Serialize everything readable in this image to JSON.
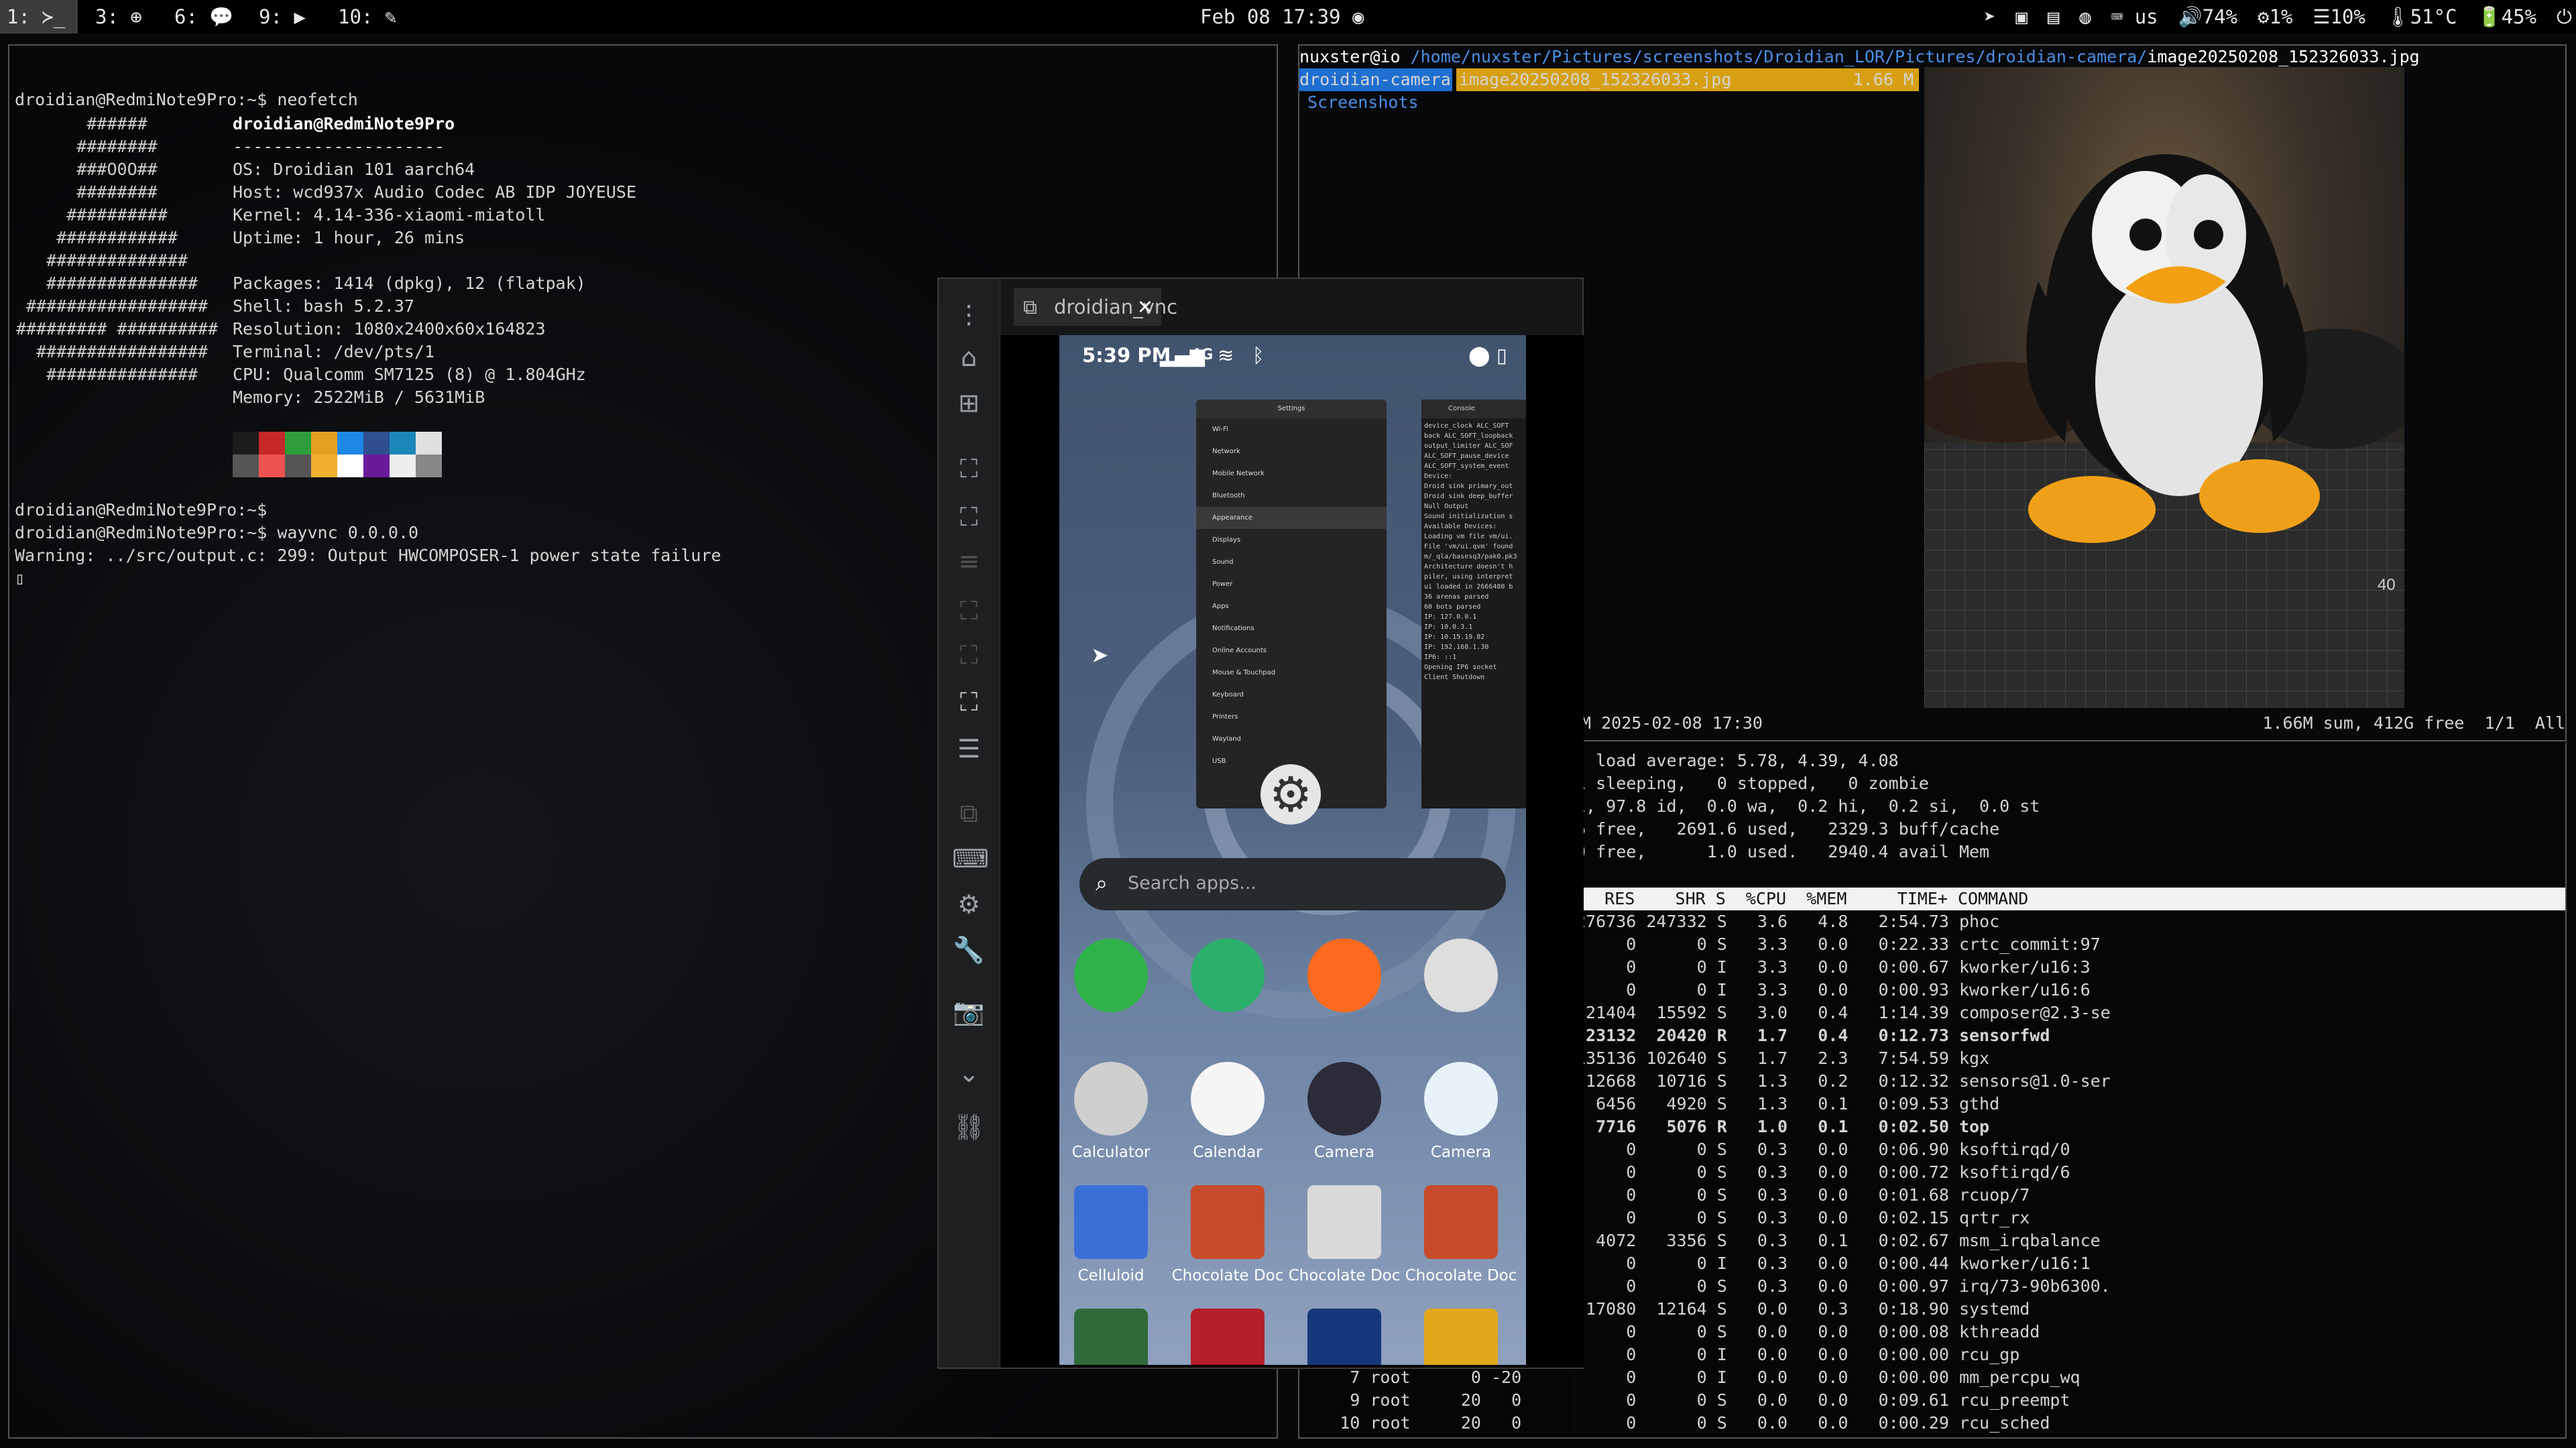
{
  "bar": {
    "workspaces": [
      {
        "label": "1: ≻_",
        "focused": true
      },
      {
        "label": "3: ⊕"
      },
      {
        "label": "6: 💬"
      },
      {
        "label": "9: ▶"
      },
      {
        "label": "10: ✎"
      }
    ],
    "datetime": "Feb 08 17:39",
    "status": [
      "us",
      "🔊74%",
      "⚙1%",
      "☰10%",
      "🌡51°C",
      "🔋45%"
    ]
  },
  "term1": {
    "cmd1": "droidian@RedmiNote9Pro:~$ neofetch",
    "title": "droidian@RedmiNote9Pro",
    "sep": "---------------------",
    "info": [
      "OS: Droidian 101 aarch64",
      "Host: wcd937x Audio Codec AB IDP JOYEUSE",
      "Kernel: 4.14-336-xiaomi-miatoll",
      "Uptime: 1 hour, 26 mins",
      "",
      "Packages: 1414 (dpkg), 12 (flatpak)",
      "Shell: bash 5.2.37",
      "Resolution: 1080x2400x60x164823",
      "Terminal: /dev/pts/1",
      "CPU: Qualcomm SM7125 (8) @ 1.804GHz",
      "Memory: 2522MiB / 5631MiB"
    ],
    "palette": [
      "#1c1c1c",
      "#c62828",
      "#2e9e3c",
      "#e0a020",
      "#1e88e5",
      "#2f4f8f",
      "#1b86b8",
      "#e0e0e0",
      "#555555",
      "#ef5350",
      "#555555",
      "#f0b030",
      "#ffffff",
      "#6a1b9a",
      "#eeeeee",
      "#888888"
    ],
    "lines": [
      "droidian@RedmiNote9Pro:~$",
      "droidian@RedmiNote9Pro:~$ wayvnc 0.0.0.0",
      "Warning: ../src/output.c: 299: Output HWCOMPOSER-1 power state failure"
    ]
  },
  "ranger": {
    "host": "nuxster@io",
    "path": "/home/nuxster/Pictures/screenshots/Droidian_LOR/Pictures/droidian-camera/",
    "file": "image20250208_152326033.jpg",
    "dir1": "droidian-camera",
    "dir2": "Screenshots",
    "file_size": "1.66 M",
    "footer_left": "M 2025-02-08 17:30",
    "footer_right": "1.66M sum, 412G free  1/1  All",
    "photo_mark": "40"
  },
  "top": {
    "lines": [
      ", load average: 5.78, 4.39, 4.08",
      "1 sleeping,   0 stopped,   0 zombie",
      "i, 97.8 id,  0.0 wa,  0.2 hi,  0.2 si,  0.0 st",
      "6 free,   2691.6 used,   2329.3 buff/cache",
      "0 free,      1.0 used.   2940.4 avail Mem"
    ],
    "header": "   RES    SHR S  %CPU  %MEM     TIME+ COMMAND",
    "rows": [
      {
        "t": "276736 247332 S   3.6   4.8   2:54.73 phoc"
      },
      {
        "t": "     0      0 S   3.3   0.0   0:22.33 crtc_commit:97"
      },
      {
        "t": "     0      0 I   3.3   0.0   0:00.67 kworker/u16:3"
      },
      {
        "t": "     0      0 I   3.3   0.0   0:00.93 kworker/u16:6"
      },
      {
        "t": " 21404  15592 S   3.0   0.4   1:14.39 composer@2.3-se"
      },
      {
        "t": " 23132  20420 R   1.7   0.4   0:12.73 sensorfwd",
        "b": true
      },
      {
        "t": "135136 102640 S   1.7   2.3   7:54.59 kgx"
      },
      {
        "t": " 12668  10716 S   1.3   0.2   0:12.32 sensors@1.0-ser"
      },
      {
        "t": "  6456   4920 S   1.3   0.1   0:09.53 gthd"
      },
      {
        "t": "  7716   5076 R   1.0   0.1   0:02.50 top",
        "b": true
      },
      {
        "t": "     0      0 S   0.3   0.0   0:06.90 ksoftirqd/0"
      },
      {
        "t": "     0      0 S   0.3   0.0   0:00.72 ksoftirqd/6"
      },
      {
        "t": "     0      0 S   0.3   0.0   0:01.68 rcuop/7"
      },
      {
        "t": "     0      0 S   0.3   0.0   0:02.15 qrtr_rx"
      },
      {
        "t": "  4072   3356 S   0.3   0.1   0:02.67 msm_irqbalance"
      },
      {
        "t": "     0      0 I   0.3   0.0   0:00.44 kworker/u16:1"
      },
      {
        "t": "     0      0 S   0.3   0.0   0:00.97 irq/73-90b6300."
      },
      {
        "t": " 17080  12164 S   0.0   0.3   0:18.90 systemd"
      },
      {
        "t": "     0      0 S   0.0   0.0   0:00.08 kthreadd"
      },
      {
        "t": "     0      0 I   0.0   0.0   0:00.00 rcu_gp"
      },
      {
        "t": "     0      0 I   0.0   0.0   0:00.00 mm_percpu_wq"
      },
      {
        "t": "     0      0 S   0.0   0.0   0:09.61 rcu_preempt"
      },
      {
        "t": "     0      0 S   0.0   0.0   0:00.29 rcu_sched"
      }
    ],
    "left_rows": [
      "     7 root      0 -20       0",
      "     9 root     20   0       0",
      "    10 root     20   0       0"
    ]
  },
  "vnc": {
    "tab": "droidian_vnc",
    "close": "✕",
    "phone": {
      "time": "5:39 PM",
      "net": "4G",
      "search": "Search apps...",
      "settings_title": "Settings",
      "settings_items": [
        "Wi-Fi",
        "Network",
        "Mobile Network",
        "Bluetooth",
        "Appearance",
        "Displays",
        "Sound",
        "Power",
        "Apps",
        "Notifications",
        "Online Accounts",
        "Mouse & Touchpad",
        "Keyboard",
        "Printers",
        "Wayland",
        "USB"
      ],
      "console_title": "Console",
      "console_lines": [
        "device_clock ALC_SOFT",
        "back ALC_SOFT_loopback",
        "output_limiter ALC_SOF",
        "ALC_SOFT_pause_device",
        "ALC_SOFT_system_event",
        "Device:",
        "Droid sink primary_out",
        "Droid sink deep_buffer",
        "Null Output",
        "Sound initialization s",
        "Available Devices:",
        "Loading vm file vm/ui.",
        "File 'vm/ui.qvm' found",
        "m/_qla/basesq3/pak0.pk3",
        "Architecture doesn't h",
        "piler, using interpret",
        "ui loaded in 2666480 b",
        "36 arenas parsed",
        "60 bots parsed",
        "IP: 127.0.0.1",
        "IP: 10.0.3.1",
        "IP: 10.15.19.82",
        "IP: 192.168.1.30",
        "IP6: ::1",
        "Opening IP6 socket",
        "Client Shutdown"
      ],
      "apps": [
        {
          "label": "",
          "color": "#2fb24a"
        },
        {
          "label": "",
          "color": "#2bb06b"
        },
        {
          "label": "",
          "color": "#ff6a1f"
        },
        {
          "label": "",
          "color": "#dedede"
        },
        {
          "label": "Calculator",
          "color": "#cfcfcf"
        },
        {
          "label": "Calendar",
          "color": "#f5f5f5"
        },
        {
          "label": "Camera",
          "color": "#2b2b3a"
        },
        {
          "label": "Camera",
          "color": "#e8f2fb"
        },
        {
          "label": "Celluloid",
          "color": "#3b6fd8"
        },
        {
          "label": "Chocolate Doc",
          "color": "#c74b2b"
        },
        {
          "label": "Chocolate Doc",
          "color": "#d9d9d9"
        },
        {
          "label": "Chocolate Doc",
          "color": "#c74b2b"
        },
        {
          "label": "",
          "color": "#2f6b3a"
        },
        {
          "label": "",
          "color": "#b3202a"
        },
        {
          "label": "",
          "color": "#16387a"
        },
        {
          "label": "",
          "color": "#e2a81c"
        }
      ]
    }
  }
}
